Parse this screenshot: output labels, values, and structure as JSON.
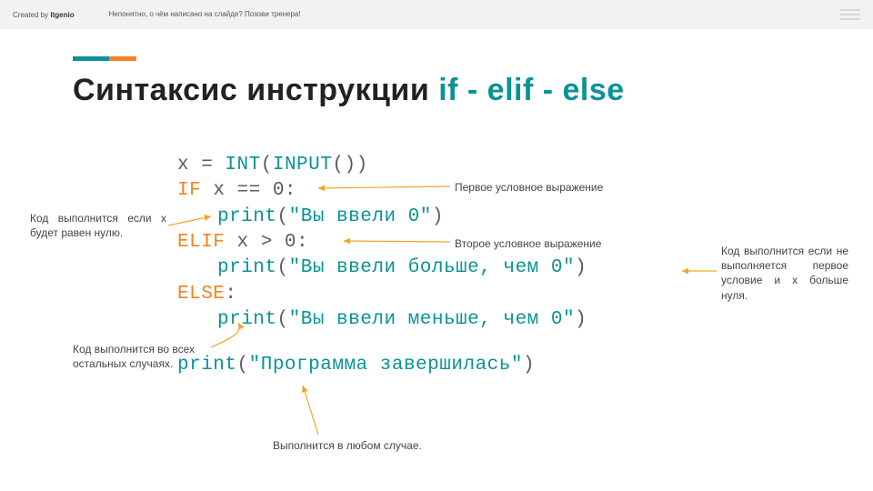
{
  "topbar": {
    "created_prefix": "Created by ",
    "created_brand": "Itgenio",
    "hint": "Непонятно, о чём написано на слайде? Позови тренера!"
  },
  "heading": {
    "prefix": "Синтаксис инструкции ",
    "kw": "if - elif - else"
  },
  "code": {
    "l1_x": "x",
    "l1_eq": " = ",
    "l1_int": "int",
    "l1_open": "(",
    "l1_input": "input",
    "l1_close": "())",
    "l2_if": "if",
    "l2_cond": " x == 0:",
    "l3_print": "print",
    "l3_open": "(",
    "l3_str": "\"Вы ввели 0\"",
    "l3_close": ")",
    "l4_elif": "elif",
    "l4_cond": " x > 0:",
    "l5_print": "print",
    "l5_open": "(",
    "l5_str": "\"Вы ввели больше, чем 0\"",
    "l5_close": ")",
    "l6_else": "else",
    "l6_colon": ":",
    "l7_print": "print",
    "l7_open": "(",
    "l7_str": "\"Вы ввели меньше, чем 0\"",
    "l7_close": ")",
    "l8_print": "print",
    "l8_open": "(",
    "l8_str": "\"Программа завершилась\"",
    "l8_close": ")"
  },
  "notes": {
    "n_first_cond": "Первое условное выражение",
    "n_zero": "Код выполнится если x будет равен нулю.",
    "n_second_cond": "Второе условное выражение",
    "n_elif": "Код выполнится если не выполняется первое условие и x больше нуля.",
    "n_else": "Код выполнится во всех остальных случаях.",
    "n_always": "Выполнится в любом случае."
  }
}
